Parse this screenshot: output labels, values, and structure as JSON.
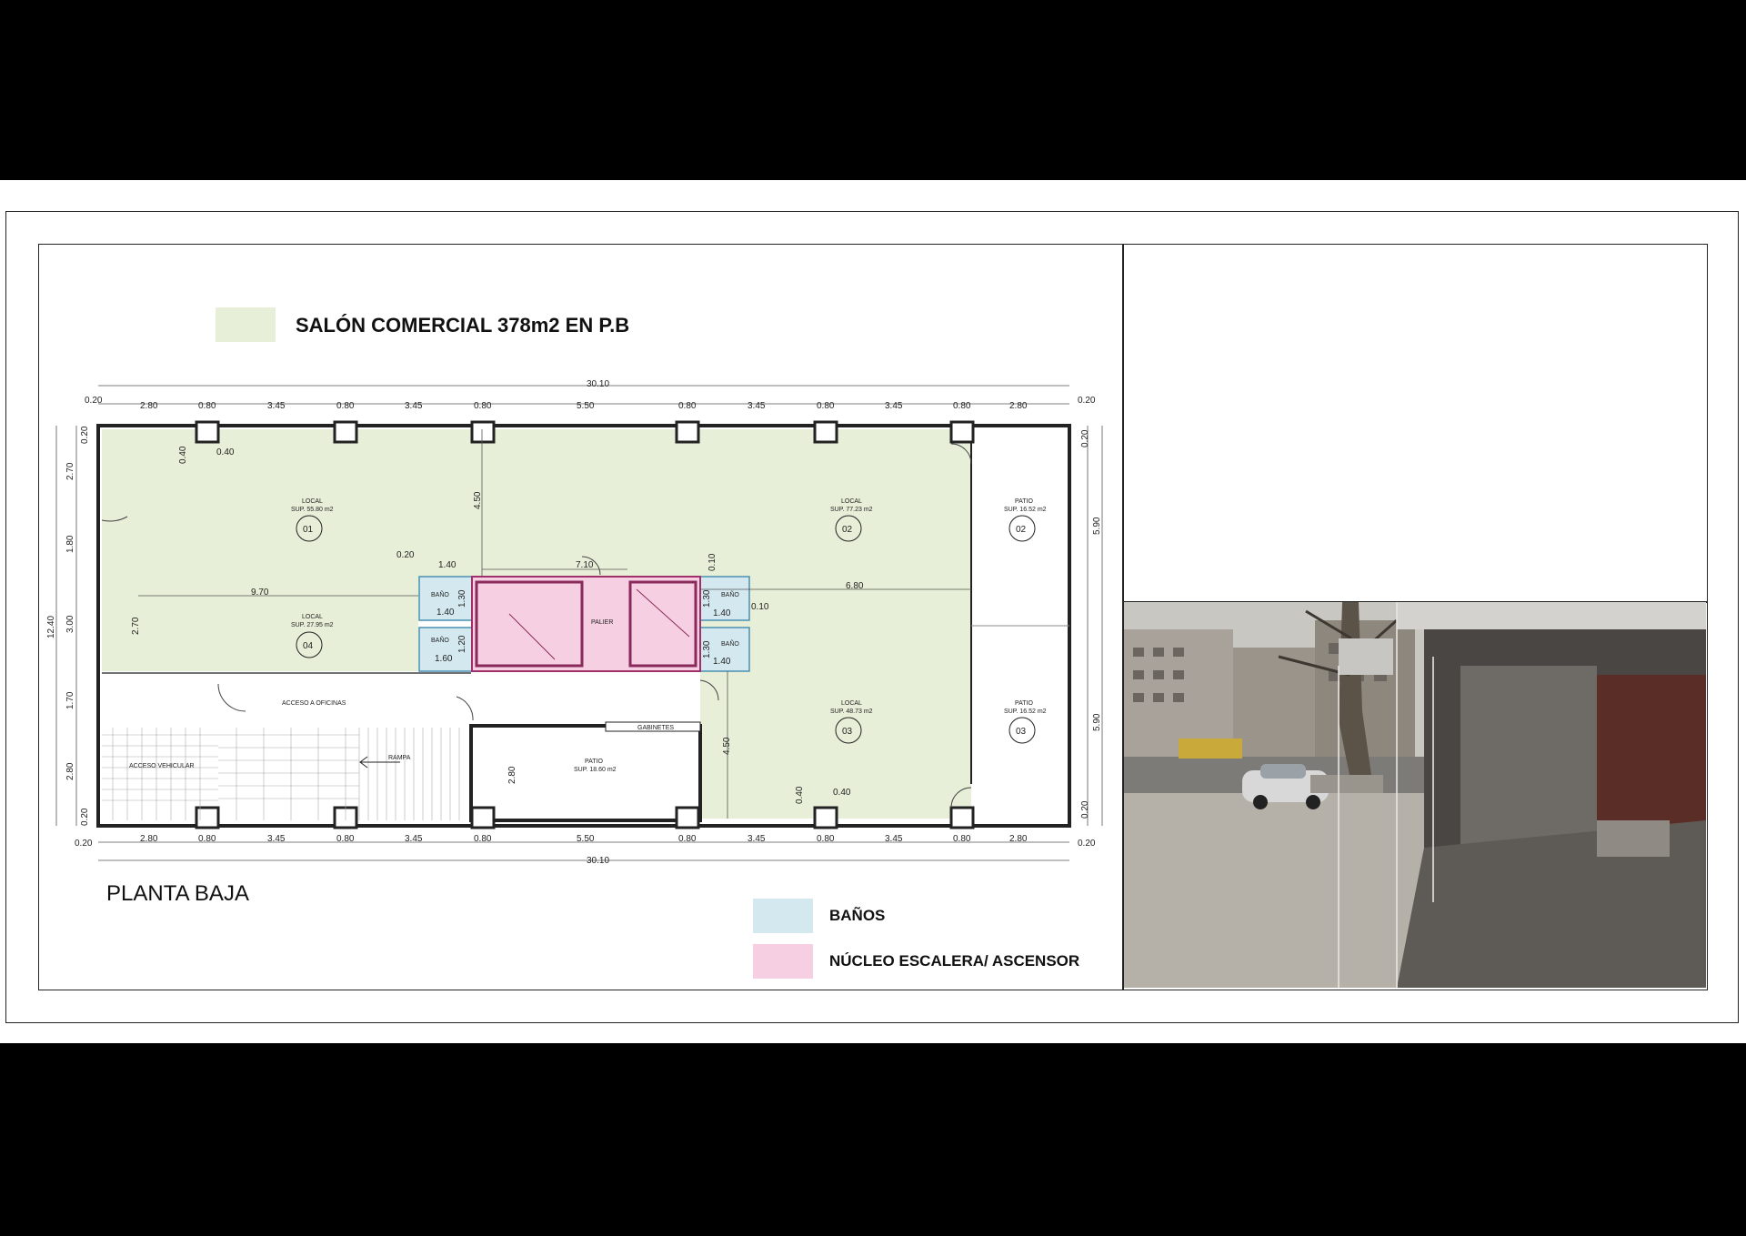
{
  "title": "SALÓN COMERCIAL 378m2 EN P.B",
  "plan_label": "PLANTA BAJA",
  "colors": {
    "salon": "#e8efd8",
    "banos": "#d4e9ef",
    "nucleo": "#f7cfe2",
    "wall": "#222222"
  },
  "legend": {
    "banos": "BAÑOS",
    "nucleo": "NÚCLEO ESCALERA/ ASCENSOR"
  },
  "dims": {
    "total": "30.10",
    "edge": "0.20",
    "top": [
      "2.80",
      "0.80",
      "3.45",
      "0.80",
      "3.45",
      "0.80",
      "5.50",
      "0.80",
      "3.45",
      "0.80",
      "3.45",
      "0.80",
      "2.80"
    ],
    "bottom": [
      "2.80",
      "0.80",
      "3.45",
      "0.80",
      "3.45",
      "0.80",
      "5.50",
      "0.80",
      "3.45",
      "0.80",
      "3.45",
      "0.80",
      "2.80"
    ],
    "left": [
      "0.20",
      "2.70",
      "1.80",
      "3.00",
      "1.70",
      "2.80",
      "0.20"
    ],
    "left_total": "12.40",
    "right": [
      "0.20",
      "5.90",
      "5.90",
      "0.20"
    ],
    "inner": {
      "d040a": "0.40",
      "d040b": "0.40",
      "d450a": "4.50",
      "d020": "0.20",
      "d140a": "1.40",
      "d710": "7.10",
      "d010a": "0.10",
      "d970": "9.70",
      "d680": "6.80",
      "d130a": "1.30",
      "d140b": "1.40",
      "d010b": "0.10",
      "d270": "2.70",
      "d130b": "1.30",
      "d120": "1.20",
      "d160": "1.60",
      "d140c": "1.40",
      "d450b": "4.50",
      "d280": "2.80",
      "d040c": "0.40",
      "d040d": "0.40"
    }
  },
  "rooms": {
    "local01": {
      "name": "LOCAL",
      "sup": "SUP. 55.80 m2",
      "num": "01"
    },
    "local02": {
      "name": "LOCAL",
      "sup": "SUP. 77.23 m2",
      "num": "02"
    },
    "local04": {
      "name": "LOCAL",
      "sup": "SUP. 27.95 m2",
      "num": "04"
    },
    "local03": {
      "name": "LOCAL",
      "sup": "SUP. 48.73 m2",
      "num": "03"
    },
    "patio02": {
      "name": "PATIO",
      "sup": "SUP. 16.52 m2",
      "num": "02"
    },
    "patio03": {
      "name": "PATIO",
      "sup": "SUP. 16.52 m2",
      "num": "03"
    },
    "patio_c": {
      "name": "PATIO",
      "sup": "SUP. 18.60 m2"
    },
    "bano1": "BAÑO",
    "bano2": "BAÑO",
    "bano3": "BAÑO",
    "bano4": "BAÑO",
    "palier": "PALIER",
    "acceso_oficinas": "ACCESO A OFICINAS",
    "acceso_vehicular": "ACCESO VEHICULAR",
    "rampa": "RAMPA",
    "gabinetes": "GABINETES"
  }
}
